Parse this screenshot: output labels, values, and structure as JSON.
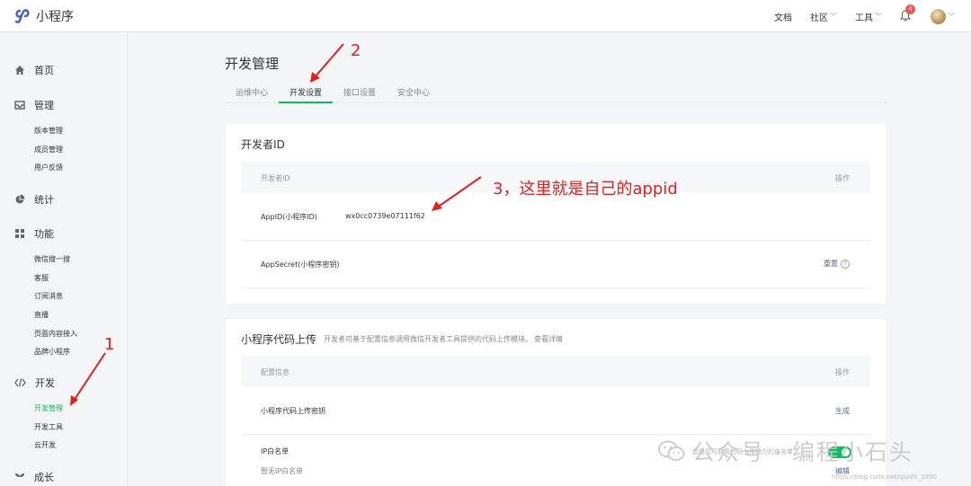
{
  "app": {
    "title": "小程序"
  },
  "topnav": {
    "docs": "文档",
    "community": "社区",
    "tools": "工具",
    "notifications": "4"
  },
  "sidebar": {
    "home": "首页",
    "manage": "管理",
    "manage_items": [
      "版本管理",
      "成员管理",
      "用户反馈"
    ],
    "stats": "统计",
    "features": "功能",
    "feature_items": [
      "微信搜一搜",
      "客服",
      "订阅消息",
      "直播",
      "页面内容接入",
      "品牌小程序"
    ],
    "dev": "开发",
    "dev_items": [
      "开发管理",
      "开发工具",
      "云开发"
    ],
    "growth": "成长"
  },
  "page": {
    "title": "开发管理"
  },
  "tabs": [
    "运维中心",
    "开发设置",
    "接口设置",
    "安全中心"
  ],
  "dev_id_card": {
    "title": "开发者ID",
    "col_id": "开发者ID",
    "col_action": "操作",
    "appid_label": "AppID(小程序ID)",
    "appid_value": "wx0cc0739e07111f62",
    "secret_label": "AppSecret(小程序密钥)",
    "secret_action": "重置",
    "help": "?"
  },
  "upload_card": {
    "title": "小程序代码上传",
    "desc": "开发者可基于配置信息调用微信开发者工具提供的代码上传模块。",
    "desc_link": "查看详情",
    "col_config": "配置信息",
    "col_action": "操作",
    "key_label": "小程序代码上传密钥",
    "key_action": "生成",
    "ip_label": "IP白名单",
    "ip_empty": "暂无IP白名单",
    "ip_action": "编辑",
    "ip_note": "启用后可调用代码上传能力的白名单"
  },
  "annotations": {
    "a1": "1",
    "a2": "2",
    "a3": "3，这里就是自己的appid"
  },
  "watermark": {
    "text": "公众号 · 编程小石头",
    "url": "https://blog.csdn.net/qiushi_1990"
  },
  "colors": {
    "accent": "#07c160",
    "link": "#576b95",
    "annotation": "#e02020"
  }
}
